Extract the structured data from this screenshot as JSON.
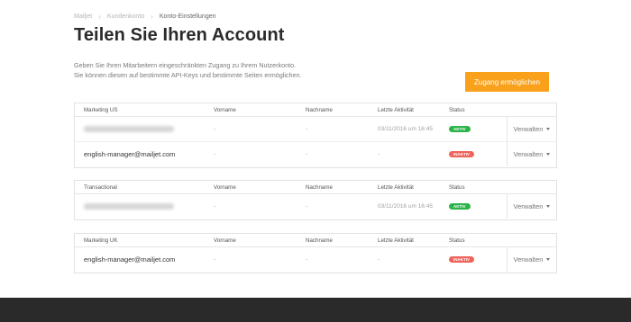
{
  "breadcrumb": [
    "Mailjet",
    "Kundenkonto",
    "Konto-Einstellungen"
  ],
  "page_title": "Teilen Sie Ihren Account",
  "description": [
    "Geben Sie Ihren Mitarbeitern eingeschränkten Zugang zu Ihrem Nutzerkonto.",
    "Sie können diesen auf bestimmte API-Keys und bestimmte Seiten ermöglichen."
  ],
  "cta_label": "Zugang ermöglichen",
  "columns": {
    "first": "Vorname",
    "last": "Nachname",
    "activity": "Letzte Aktivität",
    "status": "Status"
  },
  "manage_label": "Verwalten",
  "tables": [
    {
      "name": "Marketing US",
      "rows": [
        {
          "email": "",
          "blurred": true,
          "first": "-",
          "last": "-",
          "activity": "03/11/2016 um 16:45",
          "status": "AKTIV",
          "state": "active"
        },
        {
          "email": "english-manager@mailjet.com",
          "blurred": false,
          "first": "-",
          "last": "-",
          "activity": "-",
          "status": "INAKTIV",
          "state": "inactive"
        }
      ]
    },
    {
      "name": "Transactional",
      "rows": [
        {
          "email": "",
          "blurred": true,
          "first": "-",
          "last": "-",
          "activity": "03/11/2016 um 16:45",
          "status": "AKTIV",
          "state": "active"
        }
      ]
    },
    {
      "name": "Marketing UK",
      "rows": [
        {
          "email": "english-manager@mailjet.com",
          "blurred": false,
          "first": "-",
          "last": "-",
          "activity": "-",
          "status": "INAKTIV",
          "state": "inactive"
        }
      ]
    }
  ],
  "colors": {
    "accent": "#f9a11b",
    "active": "#2cb34a",
    "inactive": "#f0635a",
    "footer": "#2a2a2a"
  }
}
